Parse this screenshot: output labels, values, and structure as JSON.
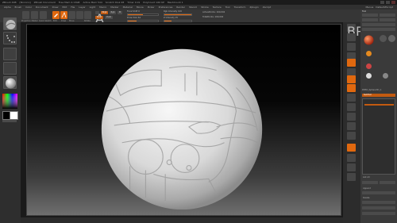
{
  "app": {
    "title_segments": [
      "ZBrush 4R8",
      "[Nnnnnn]",
      "ZBrush Document",
      "Free Mem 4.13GB",
      "Active Mem 544",
      "Scratch Disk 48",
      "Timer 0.01",
      "PolyCount 160 KP",
      "MeshCount 1"
    ],
    "window_controls": [
      "minimize",
      "maximize",
      "close"
    ]
  },
  "menu": {
    "items": [
      "Alpha",
      "Brush",
      "Color",
      "Document",
      "Draw",
      "Edit",
      "File",
      "Layer",
      "Light",
      "Macro",
      "Marker",
      "Material",
      "Movie",
      "Picker",
      "Preferences",
      "Render",
      "Stencil",
      "Stroke",
      "Texture",
      "Tool",
      "Transform",
      "Zplugin",
      "Zscript"
    ],
    "right_items": [
      "Menus",
      "DefaultZScript"
    ]
  },
  "toolbar": {
    "buttons": [
      {
        "label": "Projection Master",
        "icon": "projection-icon",
        "active": false
      },
      {
        "label": "LightBox",
        "icon": "lightbox-icon",
        "active": false
      },
      {
        "label": "Quick Sketch",
        "icon": "sketch-icon",
        "active": false
      },
      {
        "label": "Edit",
        "icon": "edit-icon",
        "active": true
      },
      {
        "label": "Draw",
        "icon": "draw-icon",
        "active": true
      },
      {
        "label": "Move",
        "icon": "move-icon",
        "active": false
      },
      {
        "label": "Scale",
        "icon": "scale-icon",
        "active": false
      },
      {
        "label": "Rotate",
        "icon": "rotate-icon",
        "active": false
      }
    ],
    "mrgb_buttons": [
      "A",
      "Mrgb",
      "Rgb",
      "M"
    ],
    "zadd_buttons": [
      "Zadd",
      "Zsub"
    ],
    "sliders": [
      {
        "label": "Focal Shift 0",
        "value": 0.5
      },
      {
        "label": "Draw Size 64",
        "value": 0.3
      },
      {
        "label": "Rgb Intensity 100",
        "value": 1.0
      },
      {
        "label": "Z Intensity 25",
        "value": 0.25
      }
    ],
    "right_labels": [
      "ActivePoints: 160,002",
      "TotalPoints: 160,002"
    ]
  },
  "left_shelf": {
    "items": [
      "Brush",
      "Stroke",
      "Alpha",
      "Texture",
      "Material",
      "Color",
      "SwitchColor"
    ],
    "color": {
      "main": "#000000",
      "secondary": "#ffffff"
    }
  },
  "canvas": {
    "background_top": "#000000",
    "background_bottom": "#6f6f6f",
    "object": "sphere-mesh"
  },
  "right_shelf": {
    "buttons": [
      "BPR",
      "SPix 3",
      "Scroll",
      "Zoom",
      "Actual",
      "AAHalf",
      "Persp",
      "Floor",
      "Local",
      "L.Sym",
      "Frame",
      "Move",
      "Scale",
      "Rotate",
      "Line Fill",
      "Transp",
      "Ghost",
      "Solo",
      "Xpose"
    ],
    "active_indices": [
      5,
      11,
      12,
      13
    ]
  },
  "palette": {
    "title": "Tool",
    "top_buttons": [
      "Load Tool",
      "Save As",
      "Copy Tool",
      "Paste Tool",
      "Import",
      "Export",
      "Clone",
      "Make PolyMesh3D",
      "GoZ",
      "All",
      "Visible"
    ],
    "lightbox_label": "Lightbox > Tools",
    "active_tool": "PM3D_Sphere3D_1",
    "subtools": [
      "SubTool",
      "Geometry",
      "ArrayMesh",
      "NanoMesh",
      "Layers",
      "FiberMesh",
      "Geometry HD",
      "Preview",
      "Surface",
      "Deformation",
      "Masking",
      "Visibility",
      "Polygroups",
      "Contact",
      "Morph Target",
      "Polypaint",
      "UV Map",
      "Texture Map",
      "Displacement Map",
      "Normal Map"
    ],
    "bottom_labels": [
      "List All",
      "New Folder",
      "Rename",
      "AutoReorder",
      "Append",
      "Insert",
      "Delete",
      "Del Other"
    ]
  }
}
